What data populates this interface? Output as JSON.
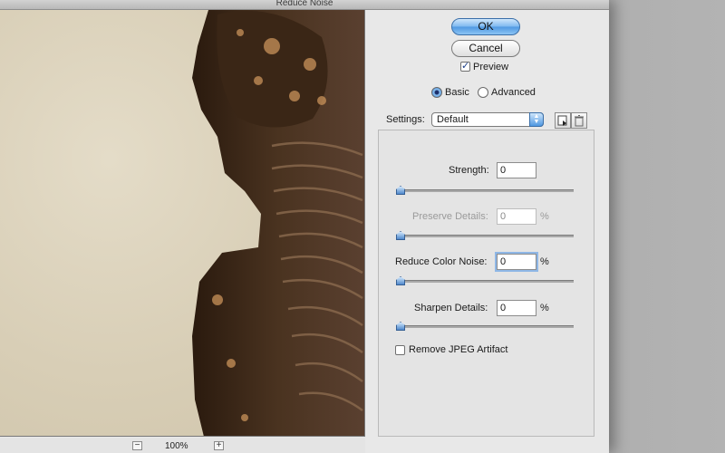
{
  "window": {
    "title": "Reduce Noise"
  },
  "buttons": {
    "ok": "OK",
    "cancel": "Cancel"
  },
  "preview_toggle": {
    "label": "Preview",
    "checked": true
  },
  "mode": {
    "basic": "Basic",
    "advanced": "Advanced",
    "selected": "basic"
  },
  "settings": {
    "label": "Settings:",
    "value": "Default"
  },
  "controls": {
    "strength": {
      "label": "Strength:",
      "value": "0",
      "unit": ""
    },
    "preserve_details": {
      "label": "Preserve Details:",
      "value": "0",
      "unit": "%"
    },
    "reduce_color_noise": {
      "label": "Reduce Color Noise:",
      "value": "0",
      "unit": "%"
    },
    "sharpen_details": {
      "label": "Sharpen Details:",
      "value": "0",
      "unit": "%"
    }
  },
  "remove_jpeg": {
    "label": "Remove JPEG Artifact",
    "checked": false
  },
  "zoom": {
    "level": "100%",
    "minus": "−",
    "plus": "+"
  },
  "colors": {
    "accent": "#4f98e2",
    "background": "#e8e8e8"
  }
}
